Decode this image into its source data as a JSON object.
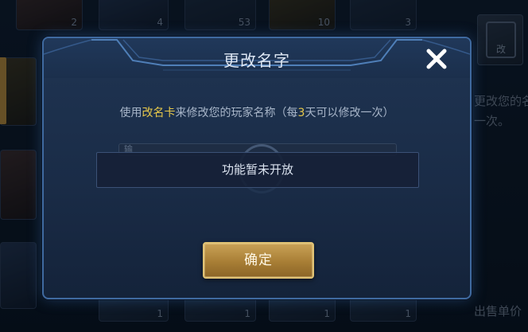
{
  "background": {
    "item_counts": [
      "2",
      "4",
      "53",
      "10",
      "3"
    ],
    "bottom_counts": [
      "1",
      "1",
      "1",
      "1"
    ],
    "side_card_glyph": "改",
    "side_text": [
      "更改您的名",
      "一次。",
      "出售单价"
    ]
  },
  "dialog": {
    "title": "更改名字",
    "description": {
      "prefix": "使用",
      "highlight1": "改名卡",
      "middle": "来修改您的玩家名称（每",
      "highlight2": "3",
      "suffix": "天可以修改一次）"
    },
    "name_field_hint": "输",
    "notice": "功能暂未开放",
    "confirm_label": "确定",
    "close_icon": "close-icon"
  },
  "colors": {
    "highlight": "#e8c94a",
    "dialog_border": "#3f6aa0",
    "button_gold": "#c9a257"
  }
}
